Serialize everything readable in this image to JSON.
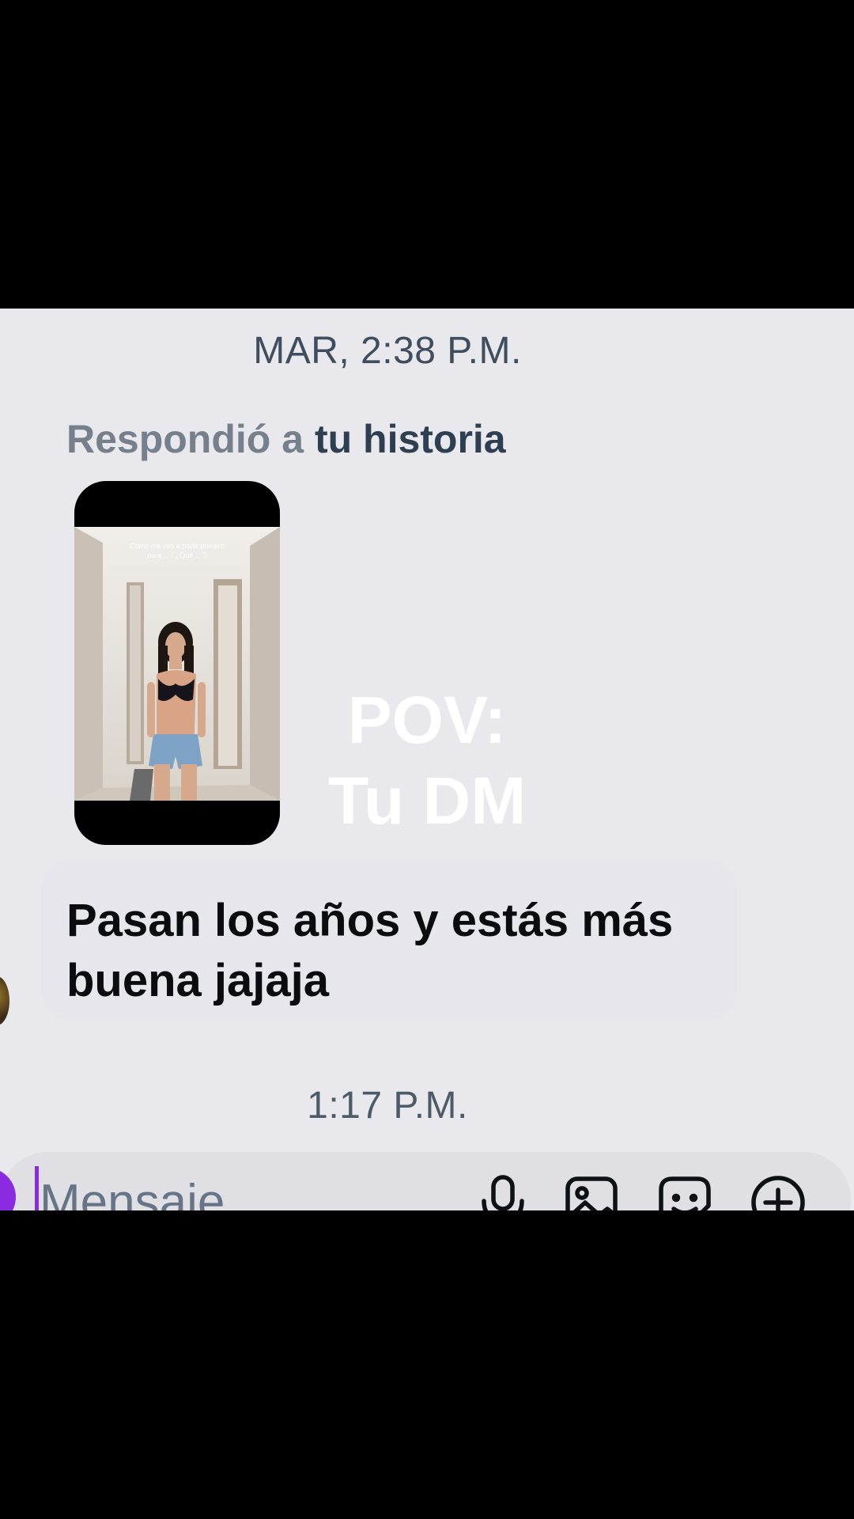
{
  "timestamps": {
    "top": "MAR, 2:38 P.M.",
    "bottom": "1:17 P.M."
  },
  "reply_context": {
    "prefix": "Respondió a",
    "target": "tu historia"
  },
  "story": {
    "caption": "Como me veo a partir primero para ... / ¿Qué ... ?"
  },
  "overlay": {
    "line1": "POV:",
    "line2": "Tu DM"
  },
  "message": {
    "text": "Pasan los años y estás más buena jajaja"
  },
  "composer": {
    "placeholder": "Mensaje..."
  },
  "icons": {
    "camera": "camera-icon",
    "mic": "microphone-icon",
    "gallery": "image-icon",
    "sticker": "sticker-icon",
    "more": "plus-circle-icon"
  },
  "colors": {
    "accent": "#8a2be2",
    "background": "#e9e8ed",
    "text": "#0b0c0f"
  }
}
